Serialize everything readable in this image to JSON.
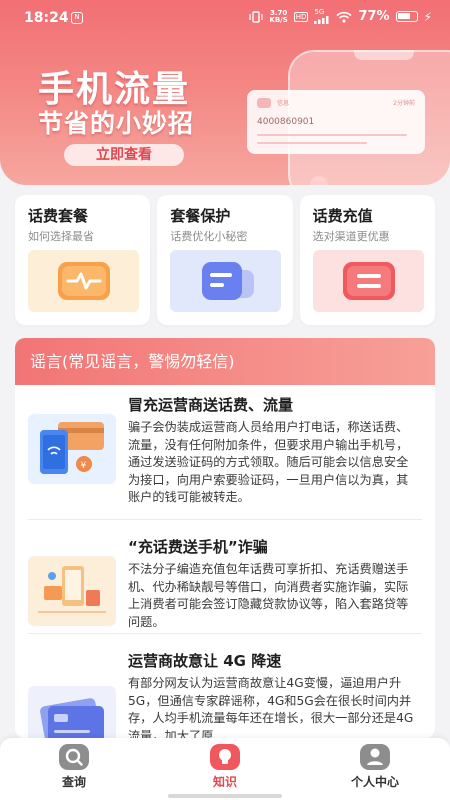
{
  "status_bar": {
    "time": "18:24",
    "app_icon_glyph": "N",
    "speed_value": "3.70",
    "speed_unit": "KB/S",
    "hd_tag": "HD",
    "network": "5G",
    "battery_percent": "77%"
  },
  "hero": {
    "title_line1": "手机流量",
    "title_line2": "节省的小妙招",
    "cta_label": "立即查看",
    "sms_number": "4000860901",
    "sms_label": "信息",
    "sms_time": "2分钟前"
  },
  "categories": [
    {
      "title": "话费套餐",
      "subtitle": "如何选择最省",
      "icon": "pulse-icon",
      "color": "#f9a04a"
    },
    {
      "title": "套餐保护",
      "subtitle": "话费优化小秘密",
      "icon": "chat-card-icon",
      "color": "#6a7ff0"
    },
    {
      "title": "话费充值",
      "subtitle": "选对渠道更优惠",
      "icon": "card-list-icon",
      "color": "#f05a5f"
    }
  ],
  "rumor": {
    "header": "谣言(常见谣言，警惕勿轻信)",
    "articles": [
      {
        "title": "冒充运营商送话费、流量",
        "body": "骗子会伪装成运营商人员给用户打电话，称送话费、流量，没有任何附加条件，但要求用户输出手机号，通过发送验证码的方式领取。随后可能会以信息安全为接口，向用户索要验证码，一旦用户信以为真，其账户的钱可能被转走。",
        "thumb_icon": "phone-wallet-illustration"
      },
      {
        "title": "“充话费送手机”诈骗",
        "body": "不法分子编造充值包年话费可享折扣、充话费赠送手机、代办稀缺靓号等借口，向消费者实施诈骗，实际上消费者可能会签订隐藏贷款协议等，陷入套路贷等问题。",
        "thumb_icon": "shopping-illustration"
      },
      {
        "title": "运营商故意让 4G 降速",
        "body": "有部分网友认为运营商故意让4G变慢，逼迫用户升5G，但通信专家辟谣称，4G和5G会在很长时间内并存，人均手机流量每年还在增长，很大一部分还是4G流量，加大了原",
        "thumb_icon": "card-illustration"
      }
    ]
  },
  "tabbar": {
    "tabs": [
      {
        "label": "查询",
        "icon": "search-icon",
        "active": false
      },
      {
        "label": "知识",
        "icon": "bulb-icon",
        "active": true
      },
      {
        "label": "个人中心",
        "icon": "user-icon",
        "active": false
      }
    ]
  },
  "colors": {
    "accent": "#e3474d",
    "hero_top": "#f26f74",
    "hero_bottom": "#f6a7a0",
    "background": "#f3f3f5"
  }
}
